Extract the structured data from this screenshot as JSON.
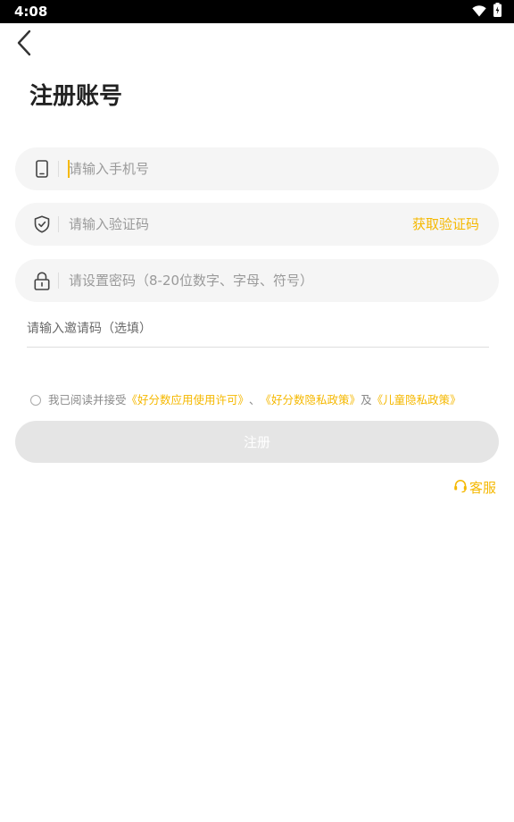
{
  "status_bar": {
    "time": "4:08"
  },
  "header": {
    "title": "注册账号"
  },
  "form": {
    "phone": {
      "placeholder": "请输入手机号",
      "value": ""
    },
    "code": {
      "placeholder": "请输入验证码",
      "value": "",
      "get_code_label": "获取验证码"
    },
    "password": {
      "placeholder": "请设置密码（8-20位数字、字母、符号）",
      "value": ""
    },
    "invite": {
      "placeholder": "请输入邀请码（选填）",
      "value": ""
    }
  },
  "agreement": {
    "prefix": "我已阅读并接受",
    "link1": "《好分数应用使用许可》",
    "sep1": "、",
    "link2": "《好分数隐私政策》",
    "sep2": "及",
    "link3": "《儿童隐私政策》"
  },
  "actions": {
    "register_label": "注册",
    "customer_service_label": "客服"
  },
  "colors": {
    "accent": "#f5b800",
    "field_bg": "#f5f5f5",
    "button_disabled_bg": "#e5e5e5"
  },
  "icons": {
    "back": "chevron-left-icon",
    "phone": "phone-icon",
    "shield": "shield-check-icon",
    "lock": "lock-icon",
    "headset": "headset-icon",
    "wifi": "wifi-icon",
    "battery": "battery-icon"
  }
}
